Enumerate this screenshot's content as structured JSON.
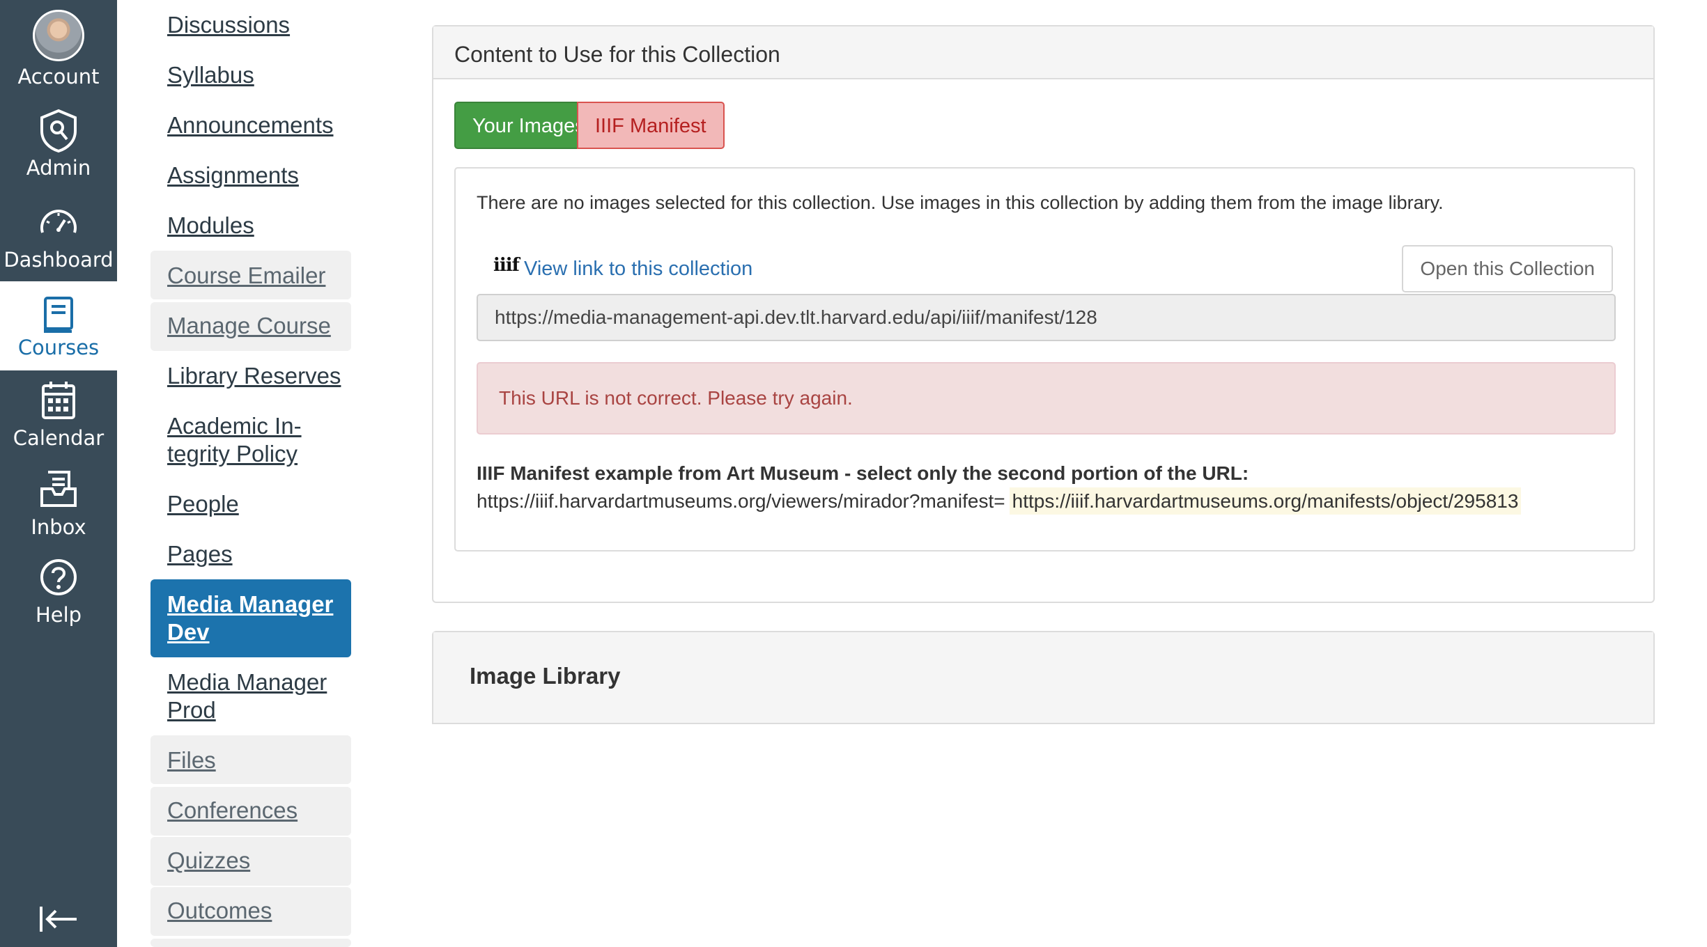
{
  "global_nav": {
    "account": "Account",
    "admin": "Admin",
    "dashboard": "Dashboard",
    "courses": "Courses",
    "calendar": "Calendar",
    "inbox": "Inbox",
    "help": "Help"
  },
  "course_nav": {
    "items": [
      {
        "label": "Discussions"
      },
      {
        "label": "Syllabus"
      },
      {
        "label": "Announcements"
      },
      {
        "label": "Assignments"
      },
      {
        "label": "Modules"
      },
      {
        "label": "Course Emailer"
      },
      {
        "label": "Manage Course"
      },
      {
        "label": "Library Reserves"
      },
      {
        "label": "Academic In-",
        "label2": "tegrity Policy"
      },
      {
        "label": "People"
      },
      {
        "label": "Pages"
      },
      {
        "label": "Media Manager",
        "label2": "Dev"
      },
      {
        "label": "Media Manager",
        "label2": "Prod"
      },
      {
        "label": "Files"
      },
      {
        "label": "Conferences"
      },
      {
        "label": "Quizzes"
      },
      {
        "label": "Outcomes"
      }
    ]
  },
  "content_panel": {
    "title": "Content to Use for this Collection",
    "tabs": {
      "your_images": "Your Images",
      "iiif_manifest": "IIIF Manifest"
    },
    "no_images_text": "There are no images selected for this collection. Use images in this collection by adding them from the image library.",
    "iiif_logo": "iiif",
    "view_link": "View link to this collection",
    "open_button": "Open this Collection",
    "url_value": "https://media-management-api.dev.tlt.harvard.edu/api/iiif/manifest/128",
    "error_text": "This URL is not correct. Please try again.",
    "example_title": "IIIF Manifest example from Art Museum - select only the second portion of the URL:",
    "example_prefix": "https://iiif.harvardartmuseums.org/viewers/mirador?manifest=",
    "example_highlight": "https://iiif.harvardartmuseums.org/manifests/object/295813"
  },
  "library_panel": {
    "title": "Image Library"
  },
  "colors": {
    "global_nav_bg": "#394b58",
    "course_nav_active": "#1c73ad",
    "your_images_tab": "#449d44",
    "iiif_tab": "#f2b8b8",
    "error_bg": "#f2dede",
    "link": "#2a6fb0"
  }
}
